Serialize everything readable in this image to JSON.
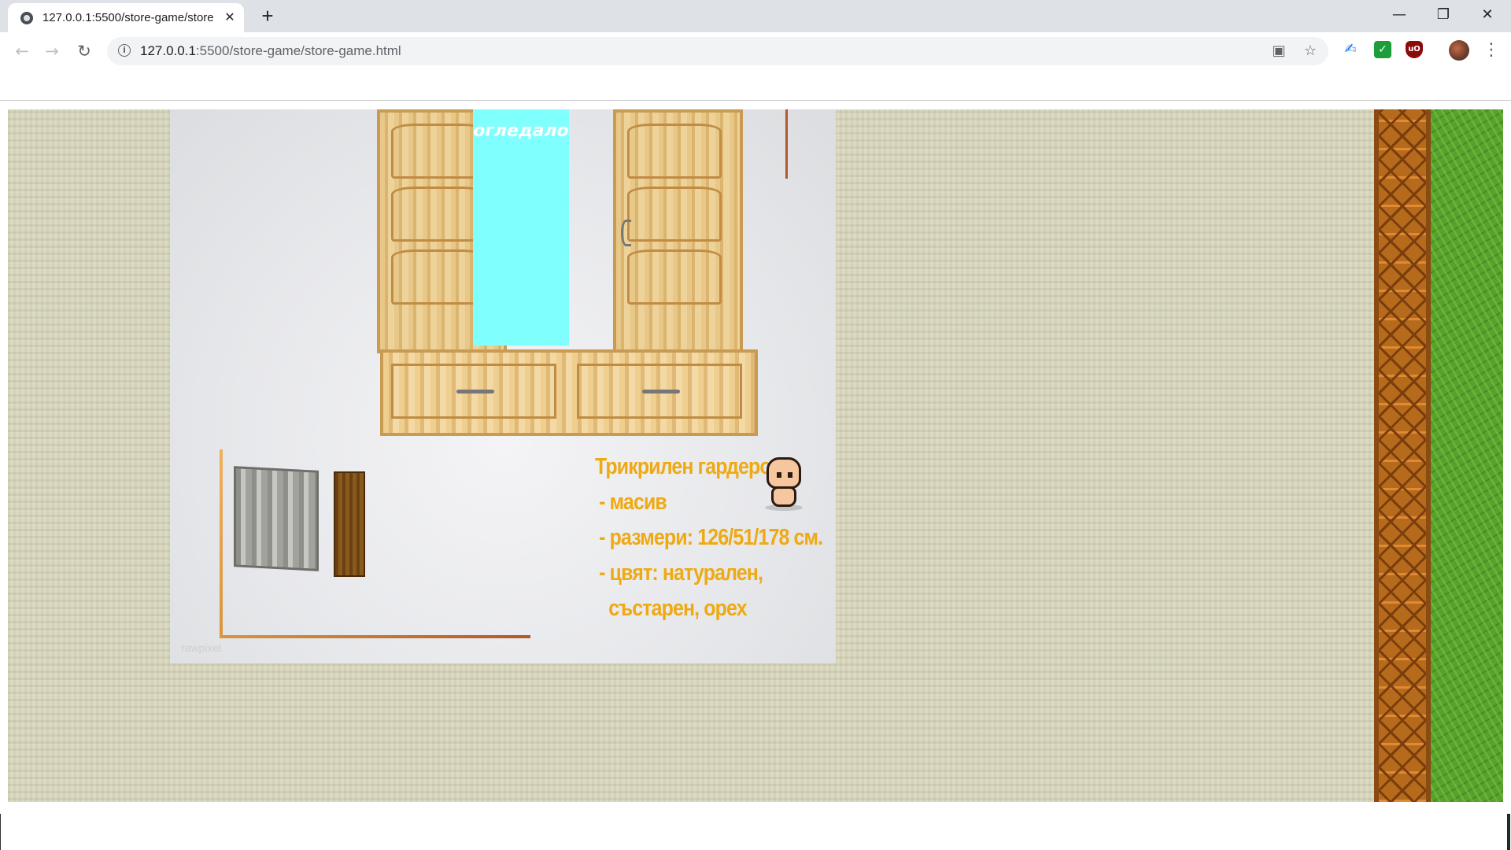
{
  "browser": {
    "tab_title": "127.0.0.1:5500/store-game/store",
    "tab_close": "✕",
    "new_tab": "+",
    "url_host": "127.0.0.1",
    "url_rest": ":5500/store-game/store-game.html",
    "icons": [
      "page-favicon-icon",
      "back-icon",
      "forward-icon",
      "reload-icon",
      "info-icon",
      "translate-icon",
      "bookmark-star-icon",
      "extension-icon",
      "checkmark-extension-icon",
      "ublock-icon",
      "profile-avatar",
      "menu-dots-icon",
      "minimize-icon",
      "restore-icon",
      "close-window-icon"
    ]
  },
  "game": {
    "mirror_label": "огледало",
    "product_description": [
      "Трикрилен гардероб",
      "- масив",
      "- размери: 126/51/178 см.",
      "- цвят: натурален,",
      "състарен, орех"
    ],
    "watermark": "rawpixel",
    "colors": {
      "description_text": "#efa912",
      "mirror": "#80ffff",
      "grass": "#58a12e",
      "fence": "#b56a1c",
      "background": "#d7d5ba"
    }
  }
}
